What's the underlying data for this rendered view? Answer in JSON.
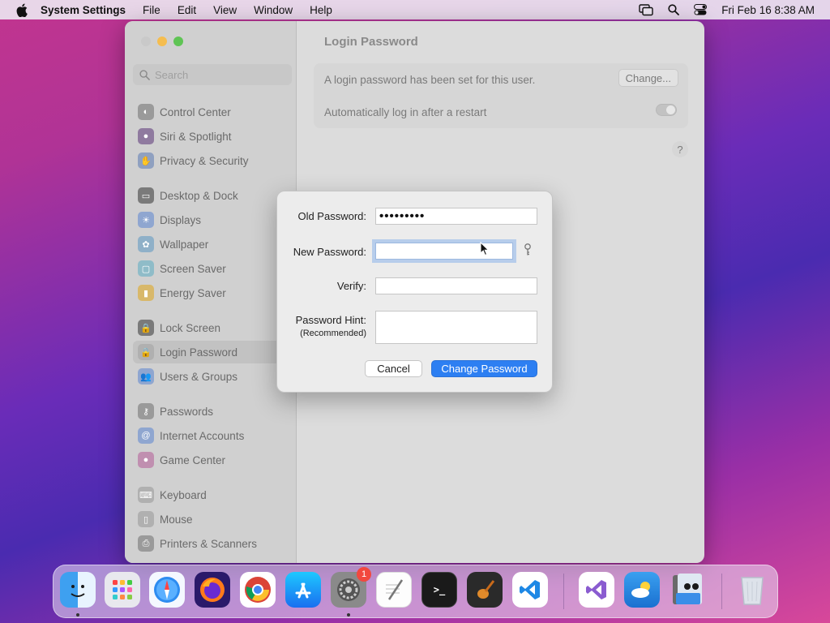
{
  "menubar": {
    "app_name": "System Settings",
    "menus": [
      "File",
      "Edit",
      "View",
      "Window",
      "Help"
    ],
    "clock": "Fri Feb 16  8:38 AM"
  },
  "window": {
    "title": "Login Password",
    "search_placeholder": "Search",
    "sidebar": [
      {
        "label": "Control Center",
        "icon": "control-center-icon",
        "color": "#9a9a9a"
      },
      {
        "label": "Siri & Spotlight",
        "icon": "siri-icon",
        "color": "#8f7a9f"
      },
      {
        "label": "Privacy & Security",
        "icon": "hand-icon",
        "color": "#8fa0c0"
      },
      {
        "label": "Desktop & Dock",
        "icon": "dock-icon",
        "color": "#7a7a7a"
      },
      {
        "label": "Displays",
        "icon": "sun-icon",
        "color": "#8fa6d0"
      },
      {
        "label": "Wallpaper",
        "icon": "flower-icon",
        "color": "#8fb0c8"
      },
      {
        "label": "Screen Saver",
        "icon": "screen-saver-icon",
        "color": "#8fbcc8"
      },
      {
        "label": "Energy Saver",
        "icon": "battery-icon",
        "color": "#d8b86a"
      },
      {
        "label": "Lock Screen",
        "icon": "lock-icon",
        "color": "#7a7a7a"
      },
      {
        "label": "Login Password",
        "icon": "lock-icon",
        "color": "#b0b0b0",
        "selected": true
      },
      {
        "label": "Users & Groups",
        "icon": "users-icon",
        "color": "#8fa6d0"
      },
      {
        "label": "Passwords",
        "icon": "key-icon",
        "color": "#9a9a9a"
      },
      {
        "label": "Internet Accounts",
        "icon": "at-icon",
        "color": "#8fa6d0"
      },
      {
        "label": "Game Center",
        "icon": "game-center-icon",
        "color": "#c08fb0"
      },
      {
        "label": "Keyboard",
        "icon": "keyboard-icon",
        "color": "#b0b0b0"
      },
      {
        "label": "Mouse",
        "icon": "mouse-icon",
        "color": "#b0b0b0"
      },
      {
        "label": "Printers & Scanners",
        "icon": "printer-icon",
        "color": "#9a9a9a"
      }
    ],
    "settings": {
      "password_status": "A login password has been set for this user.",
      "change_button": "Change...",
      "auto_login_label": "Automatically log in after a restart",
      "auto_login_on": false,
      "help": "?"
    }
  },
  "dialog": {
    "old_password_label": "Old Password:",
    "old_password_value": "•••••••••",
    "new_password_label": "New Password:",
    "new_password_value": "",
    "verify_label": "Verify:",
    "verify_value": "",
    "hint_label": "Password Hint:",
    "hint_sublabel": "(Recommended)",
    "hint_value": "",
    "cancel_button": "Cancel",
    "confirm_button": "Change Password"
  },
  "dock": {
    "apps": [
      "finder",
      "launchpad",
      "safari",
      "firefox",
      "chrome",
      "app-store",
      "system-settings",
      "textedit",
      "terminal",
      "garageband",
      "vscode",
      "visual-studio",
      "weather",
      "preview",
      "trash"
    ],
    "system_settings_badge": "1",
    "terminal_glyph": ">_"
  },
  "colors": {
    "accent": "#2d7ff2",
    "badge": "#f2483e"
  }
}
